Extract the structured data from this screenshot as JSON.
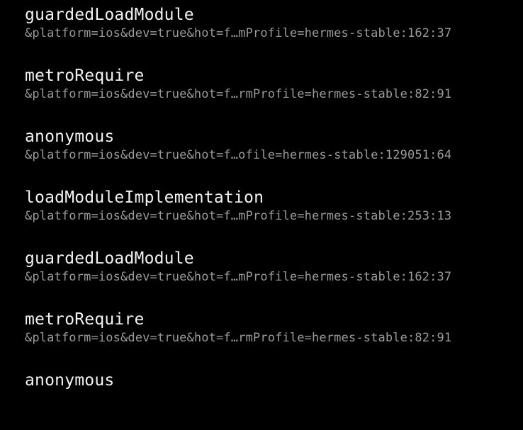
{
  "stack_frames": [
    {
      "function": "guardedLoadModule",
      "location": "&platform=ios&dev=true&hot=f…mProfile=hermes-stable:162:37"
    },
    {
      "function": "metroRequire",
      "location": "&platform=ios&dev=true&hot=f…rmProfile=hermes-stable:82:91"
    },
    {
      "function": "anonymous",
      "location": "&platform=ios&dev=true&hot=f…ofile=hermes-stable:129051:64"
    },
    {
      "function": "loadModuleImplementation",
      "location": "&platform=ios&dev=true&hot=f…mProfile=hermes-stable:253:13"
    },
    {
      "function": "guardedLoadModule",
      "location": "&platform=ios&dev=true&hot=f…mProfile=hermes-stable:162:37"
    },
    {
      "function": "metroRequire",
      "location": "&platform=ios&dev=true&hot=f…rmProfile=hermes-stable:82:91"
    },
    {
      "function": "anonymous",
      "location": ""
    }
  ]
}
